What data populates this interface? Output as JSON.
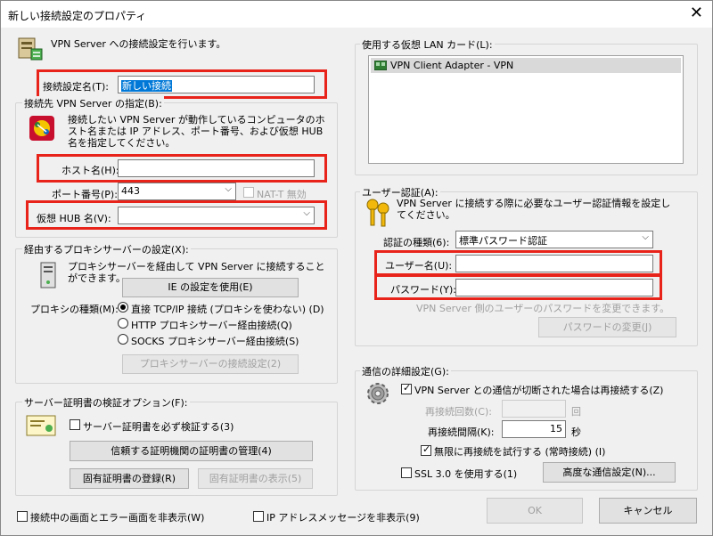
{
  "window": {
    "title": "新しい接続設定のプロパティ",
    "close": "✕"
  },
  "header": {
    "description": "VPN Server への接続設定を行います。"
  },
  "account": {
    "label": "接続設定名(T):",
    "value": "新しい接続"
  },
  "server": {
    "group_title": "接続先 VPN Server の指定(B):",
    "description": "接続したい VPN Server が動作しているコンピュータのホスト名または IP アドレス、ポート番号、および仮想 HUB 名を指定してください。",
    "host_label": "ホスト名(H):",
    "host_value": "",
    "port_label": "ポート番号(P):",
    "port_value": "443",
    "natt_label": "NAT-T 無効",
    "hub_label": "仮想 HUB 名(V):",
    "hub_value": ""
  },
  "proxy": {
    "group_title": "経由するプロキシサーバーの設定(X):",
    "description": "プロキシサーバーを経由して VPN Server に接続することができます。",
    "ie_button": "IE の設定を使用(E)",
    "type_label": "プロキシの種類(M):",
    "options": [
      "直接 TCP/IP 接続 (プロキシを使わない) (D)",
      "HTTP プロキシサーバー経由接続(Q)",
      "SOCKS プロキシサーバー経由接続(S)"
    ],
    "settings_button": "プロキシサーバーの接続設定(2)"
  },
  "cert": {
    "group_title": "サーバー証明書の検証オプション(F):",
    "verify_label": "サーバー証明書を必ず検証する(3)",
    "manage_button": "信頼する証明機関の証明書の管理(4)",
    "register_button": "固有証明書の登録(R)",
    "show_button": "固有証明書の表示(5)"
  },
  "bottom": {
    "hide_screens_label": "接続中の画面とエラー画面を非表示(W)",
    "hide_ip_label": "IP アドレスメッセージを非表示(9)",
    "ok": "OK",
    "cancel": "キャンセル"
  },
  "nic": {
    "group_title": "使用する仮想 LAN カード(L):",
    "items": [
      "VPN Client Adapter - VPN"
    ]
  },
  "auth": {
    "group_title": "ユーザー認証(A):",
    "description": "VPN Server に接続する際に必要なユーザー認証情報を設定してください。",
    "type_label": "認証の種類(6):",
    "type_value": "標準パスワード認証",
    "user_label": "ユーザー名(U):",
    "user_value": "",
    "password_label": "パスワード(Y):",
    "password_value": "",
    "hint": "VPN Server 側のユーザーのパスワードを変更できます。",
    "change_button": "パスワードの変更(J)"
  },
  "advanced": {
    "group_title": "通信の詳細設定(G):",
    "reconnect_label": "VPN Server との通信が切断された場合は再接続する(Z)",
    "retry_count_label": "再接続回数(C):",
    "retry_count_unit": "回",
    "retry_interval_label": "再接続間隔(K):",
    "retry_interval_value": "15",
    "retry_interval_unit": "秒",
    "infinite_label": "無限に再接続を試行する (常時接続) (I)",
    "ssl3_label": "SSL 3.0 を使用する(1)",
    "advanced_button": "高度な通信設定(N)..."
  }
}
